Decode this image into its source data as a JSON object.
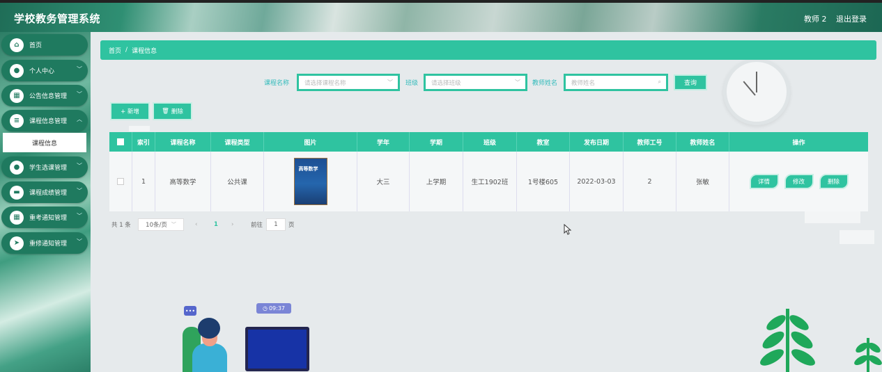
{
  "app": {
    "title": "学校教务管理系统"
  },
  "header": {
    "user": "教师 2",
    "logout": "退出登录"
  },
  "sidebar": {
    "items": [
      {
        "label": "首页",
        "icon": "home-icon"
      },
      {
        "label": "个人中心",
        "icon": "user-icon"
      },
      {
        "label": "公告信息管理",
        "icon": "grid-icon"
      },
      {
        "label": "课程信息管理",
        "icon": "list-icon"
      },
      {
        "label": "学生选课管理",
        "icon": "user-icon"
      },
      {
        "label": "课程成绩管理",
        "icon": "chat-icon"
      },
      {
        "label": "重考通知管理",
        "icon": "grid-icon"
      },
      {
        "label": "重修通知管理",
        "icon": "send-icon"
      }
    ],
    "active_sub": "课程信息"
  },
  "breadcrumb": {
    "home": "首页",
    "separator": "/",
    "current": "课程信息"
  },
  "search": {
    "course_label": "课程名称",
    "course_placeholder": "请选择课程名称",
    "class_label": "班级",
    "class_placeholder": "请选择班级",
    "teacher_label": "教师姓名",
    "teacher_placeholder": "教师姓名",
    "query": "查询"
  },
  "actions": {
    "add": "+ 新增",
    "delete": "删除"
  },
  "table": {
    "headers": [
      "索引",
      "课程名称",
      "课程类型",
      "图片",
      "学年",
      "学期",
      "班级",
      "教室",
      "发布日期",
      "教师工号",
      "教师姓名",
      "操作"
    ],
    "rows": [
      {
        "index": "1",
        "course": "高等数学",
        "type": "公共课",
        "image_title": "高等数学",
        "year": "大三",
        "term": "上学期",
        "class": "生工1902班",
        "room": "1号楼605",
        "date": "2022-03-03",
        "teacher_id": "2",
        "teacher_name": "张敏",
        "detail": "详情",
        "edit": "修改",
        "remove": "删除"
      }
    ]
  },
  "pagination": {
    "total": "共 1 条",
    "page_size": "10条/页",
    "current_page": "1",
    "goto_label": "前往",
    "goto_value": "1",
    "page_unit": "页"
  },
  "illustration": {
    "time": "09:37",
    "chat": "•••"
  },
  "colors": {
    "accent": "#2fc3a0",
    "sidebar_item": "#1f7a5f"
  }
}
